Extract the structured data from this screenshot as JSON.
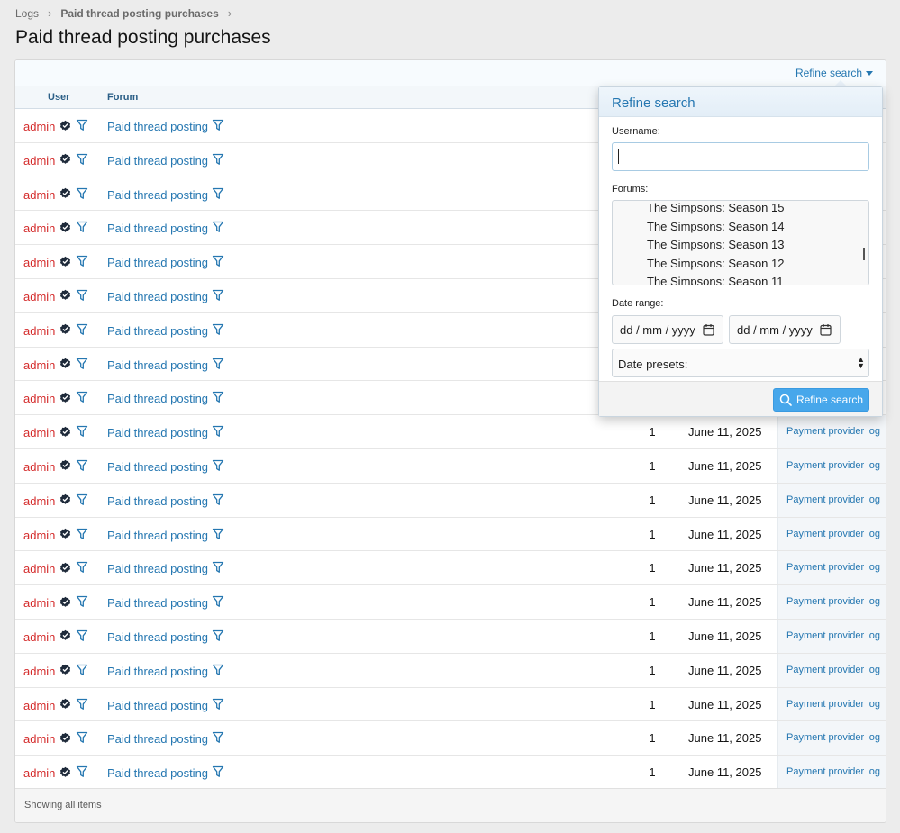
{
  "breadcrumb": [
    {
      "label": "Logs"
    },
    {
      "label": "Paid thread posting purchases"
    }
  ],
  "page_title": "Paid thread posting purchases",
  "toolbar": {
    "refine_label": "Refine search"
  },
  "table": {
    "headers": {
      "user": "User",
      "forum": "Forum"
    },
    "rows": [
      {
        "user": "admin",
        "forum": "Paid thread posting",
        "qty": "",
        "date": "",
        "action": ""
      },
      {
        "user": "admin",
        "forum": "Paid thread posting",
        "qty": "",
        "date": "",
        "action": ""
      },
      {
        "user": "admin",
        "forum": "Paid thread posting",
        "qty": "",
        "date": "",
        "action": ""
      },
      {
        "user": "admin",
        "forum": "Paid thread posting",
        "qty": "",
        "date": "",
        "action": ""
      },
      {
        "user": "admin",
        "forum": "Paid thread posting",
        "qty": "",
        "date": "",
        "action": ""
      },
      {
        "user": "admin",
        "forum": "Paid thread posting",
        "qty": "",
        "date": "",
        "action": ""
      },
      {
        "user": "admin",
        "forum": "Paid thread posting",
        "qty": "",
        "date": "",
        "action": ""
      },
      {
        "user": "admin",
        "forum": "Paid thread posting",
        "qty": "",
        "date": "",
        "action": ""
      },
      {
        "user": "admin",
        "forum": "Paid thread posting",
        "qty": "",
        "date": "",
        "action": ""
      },
      {
        "user": "admin",
        "forum": "Paid thread posting",
        "qty": "1",
        "date": "June 11, 2025",
        "action": "Payment provider log"
      },
      {
        "user": "admin",
        "forum": "Paid thread posting",
        "qty": "1",
        "date": "June 11, 2025",
        "action": "Payment provider log"
      },
      {
        "user": "admin",
        "forum": "Paid thread posting",
        "qty": "1",
        "date": "June 11, 2025",
        "action": "Payment provider log"
      },
      {
        "user": "admin",
        "forum": "Paid thread posting",
        "qty": "1",
        "date": "June 11, 2025",
        "action": "Payment provider log"
      },
      {
        "user": "admin",
        "forum": "Paid thread posting",
        "qty": "1",
        "date": "June 11, 2025",
        "action": "Payment provider log"
      },
      {
        "user": "admin",
        "forum": "Paid thread posting",
        "qty": "1",
        "date": "June 11, 2025",
        "action": "Payment provider log"
      },
      {
        "user": "admin",
        "forum": "Paid thread posting",
        "qty": "1",
        "date": "June 11, 2025",
        "action": "Payment provider log"
      },
      {
        "user": "admin",
        "forum": "Paid thread posting",
        "qty": "1",
        "date": "June 11, 2025",
        "action": "Payment provider log"
      },
      {
        "user": "admin",
        "forum": "Paid thread posting",
        "qty": "1",
        "date": "June 11, 2025",
        "action": "Payment provider log"
      },
      {
        "user": "admin",
        "forum": "Paid thread posting",
        "qty": "1",
        "date": "June 11, 2025",
        "action": "Payment provider log"
      },
      {
        "user": "admin",
        "forum": "Paid thread posting",
        "qty": "1",
        "date": "June 11, 2025",
        "action": "Payment provider log"
      }
    ]
  },
  "footer": {
    "status": "Showing all items"
  },
  "refine_popup": {
    "title": "Refine search",
    "username_label": "Username:",
    "username_value": "",
    "forums_label": "Forums:",
    "forums": [
      "The Simpsons: Season 15",
      "The Simpsons: Season 14",
      "The Simpsons: Season 13",
      "The Simpsons: Season 12",
      "The Simpsons: Season 11"
    ],
    "date_range_label": "Date range:",
    "date_start_placeholder": "dd / mm / yyyy",
    "date_end_placeholder": "dd / mm / yyyy",
    "presets_value": "Date presets:",
    "submit_label": "Refine search"
  },
  "colors": {
    "link": "#2577b1",
    "username": "#d42b2b",
    "button": "#47a7eb"
  },
  "icons": {
    "verified": "verified-badge-icon",
    "filter": "filter-icon",
    "calendar": "calendar-icon",
    "search": "search-icon"
  }
}
